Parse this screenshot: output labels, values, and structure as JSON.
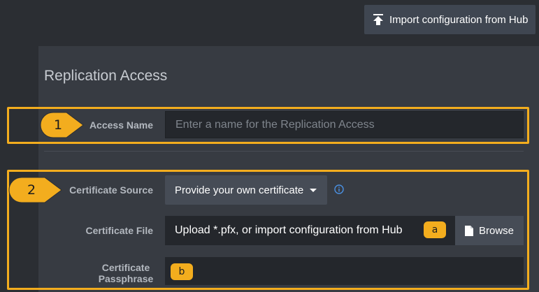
{
  "header": {
    "import_button_label": "Import configuration from Hub",
    "import_icon": "upload-icon"
  },
  "panel": {
    "title": "Replication Access"
  },
  "callouts": {
    "one": "1",
    "two": "2",
    "a": "a",
    "b": "b",
    "color": "#f3ad1e"
  },
  "form": {
    "access_name": {
      "label": "Access Name",
      "placeholder": "Enter a name for the Replication Access",
      "value": ""
    },
    "certificate_source": {
      "label": "Certificate Source",
      "selected": "Provide your own certificate",
      "info_icon": "info-icon"
    },
    "certificate_file": {
      "label": "Certificate File",
      "value": "Upload *.pfx, or import configuration from Hub",
      "browse_label": "Browse",
      "browse_icon": "document-icon"
    },
    "certificate_passphrase": {
      "label_line1": "Certificate",
      "label_line2": "Passphrase",
      "value": ""
    }
  },
  "colors": {
    "background": "#2b2e33",
    "panel": "#373b42",
    "highlight": "#f3ad1e",
    "info_blue": "#4a90e2"
  }
}
